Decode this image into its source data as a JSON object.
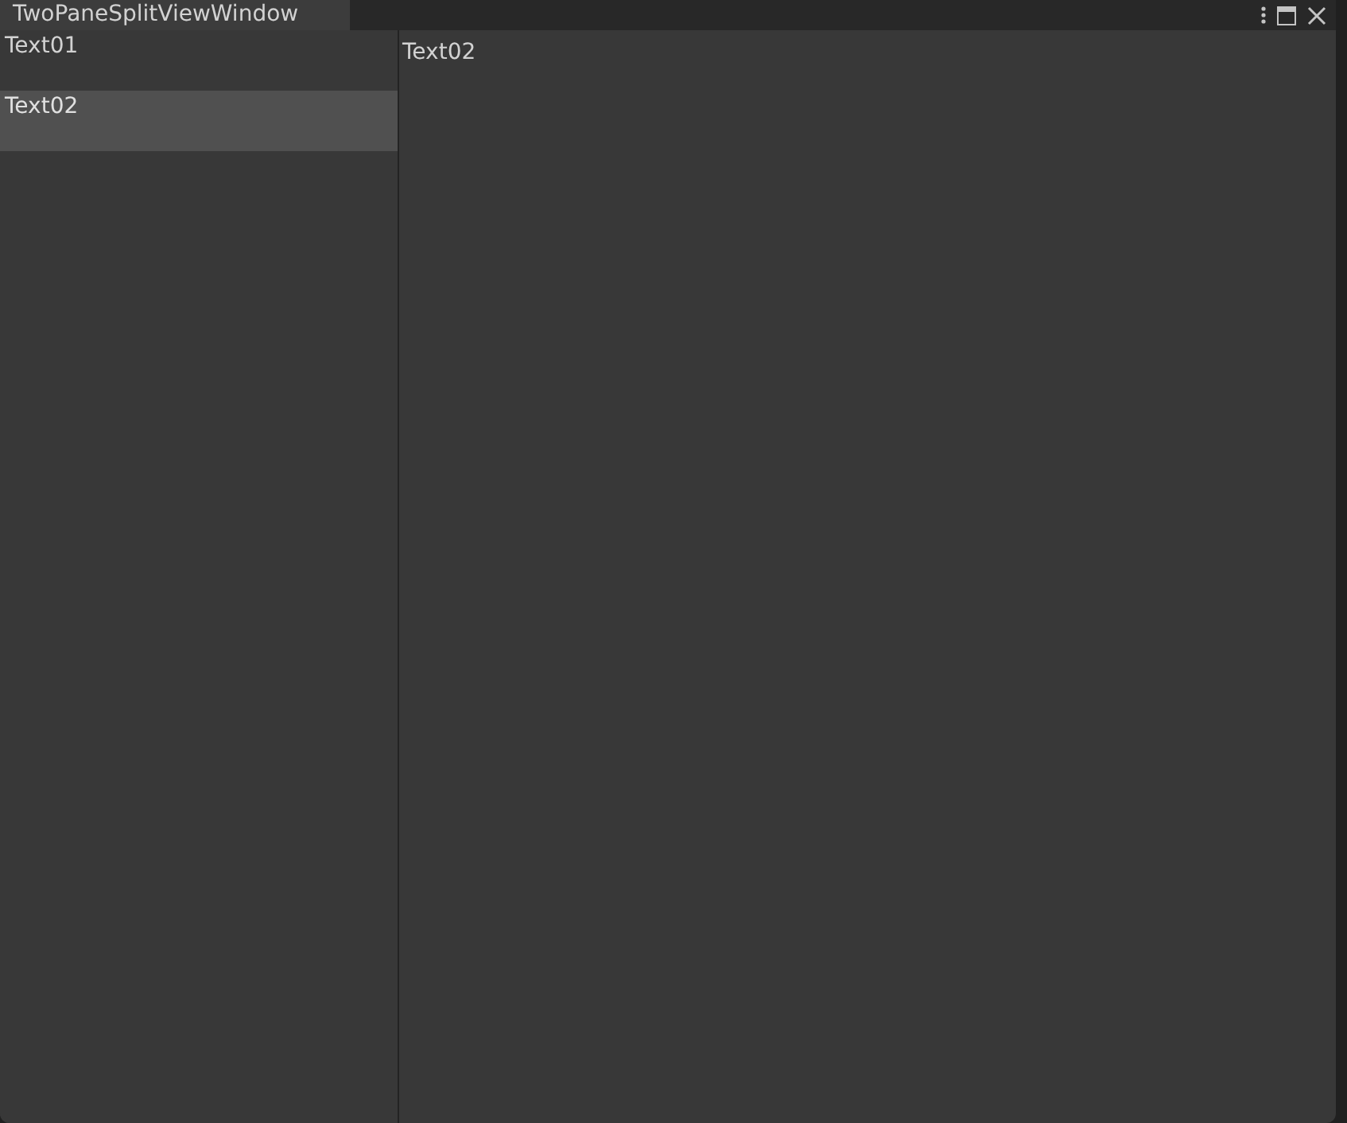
{
  "window": {
    "title": "TwoPaneSplitViewWindow"
  },
  "list": {
    "items": [
      {
        "label": "Text01",
        "selected": false
      },
      {
        "label": "Text02",
        "selected": true
      }
    ]
  },
  "detail": {
    "text": "Text02"
  }
}
